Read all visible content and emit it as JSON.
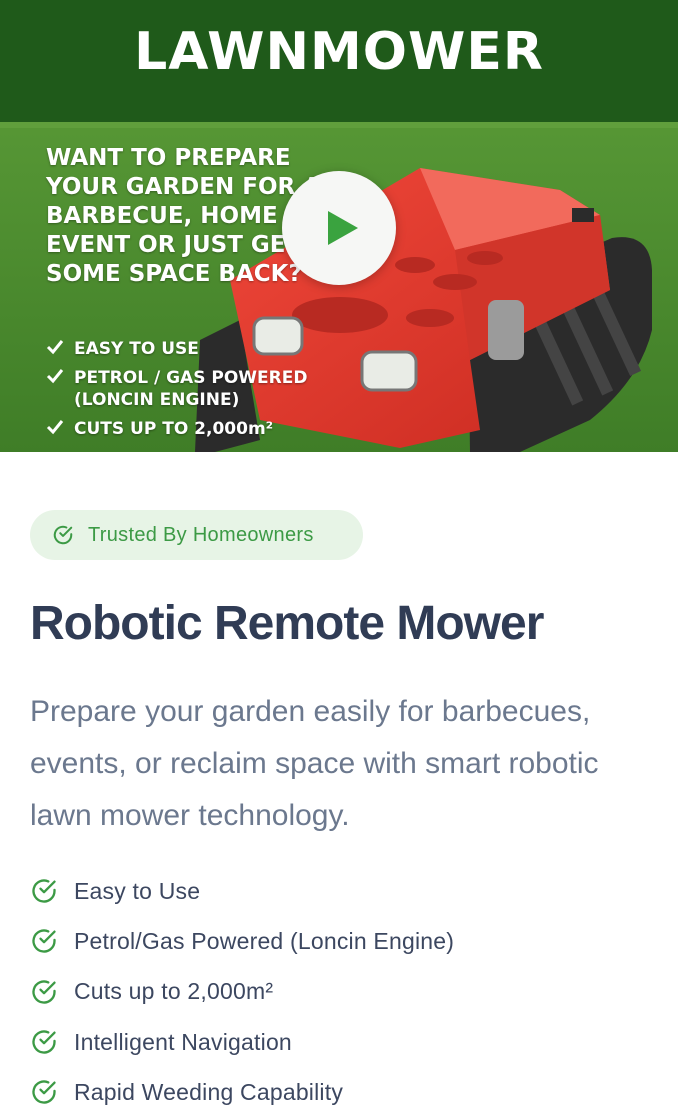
{
  "video": {
    "banner_title": "LAWNMOWER",
    "headline": "WANT TO PREPARE YOUR GARDEN FOR A... BARBECUE, HOME EVENT OR JUST GET SOME SPACE BACK?",
    "checklist": [
      "EASY TO USE",
      "PETROL / GAS POWERED (LONCIN ENGINE)",
      "CUTS UP TO 2,000m²"
    ],
    "play_icon": "play-icon",
    "colors": {
      "banner": "#1f5a1a",
      "grass": "#4d8f2f",
      "mower": "#e03a2c",
      "play": "#3aa33f"
    }
  },
  "badge": {
    "label": "Trusted By Homeowners",
    "icon": "check-circle-icon"
  },
  "product": {
    "title": "Robotic Remote Mower",
    "description": "Prepare your garden easily for barbecues, events, or reclaim space with smart robotic lawn mower technology."
  },
  "features": [
    {
      "label": "Easy to Use",
      "icon": "check-circle-icon"
    },
    {
      "label": "Petrol/Gas Powered (Loncin Engine)",
      "icon": "check-circle-icon"
    },
    {
      "label": "Cuts up to 2,000m²",
      "icon": "check-circle-icon"
    },
    {
      "label": "Intelligent Navigation",
      "icon": "check-circle-icon"
    },
    {
      "label": "Rapid Weeding Capability",
      "icon": "check-circle-icon"
    }
  ],
  "colors": {
    "accent": "#3c9a45",
    "badge_bg": "#e7f4e6",
    "title": "#303c55",
    "body": "#6b788e"
  }
}
